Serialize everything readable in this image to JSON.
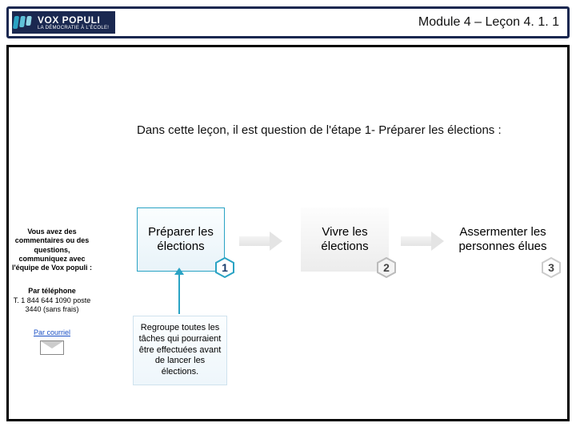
{
  "header": {
    "logo_name": "VOX POPULI",
    "logo_tagline": "LA DÉMOCRATIE À L'ÉCOLE!",
    "title": "Module 4 – Leçon 4. 1. 1"
  },
  "lesson_intro": "Dans cette leçon, il est question de l'étape 1- Préparer les élections :",
  "sidebar": {
    "contact_intro": "Vous avez des commentaires ou des questions, communiquez avec l'équipe de Vox populi :",
    "phone_label": "Par téléphone",
    "phone_number": "T. 1 844 644 1090 poste 3440 (sans frais)",
    "email_link": "Par courriel"
  },
  "steps": [
    {
      "label": "Préparer les élections",
      "num": "1"
    },
    {
      "label": "Vivre les élections",
      "num": "2"
    },
    {
      "label": "Assermenter les personnes élues",
      "num": "3"
    }
  ],
  "detail": "Regroupe toutes les tâches qui pourraient être effectuées avant de lancer les élections.",
  "colors": {
    "navy": "#1a2850",
    "teal": "#2aa3c4"
  }
}
